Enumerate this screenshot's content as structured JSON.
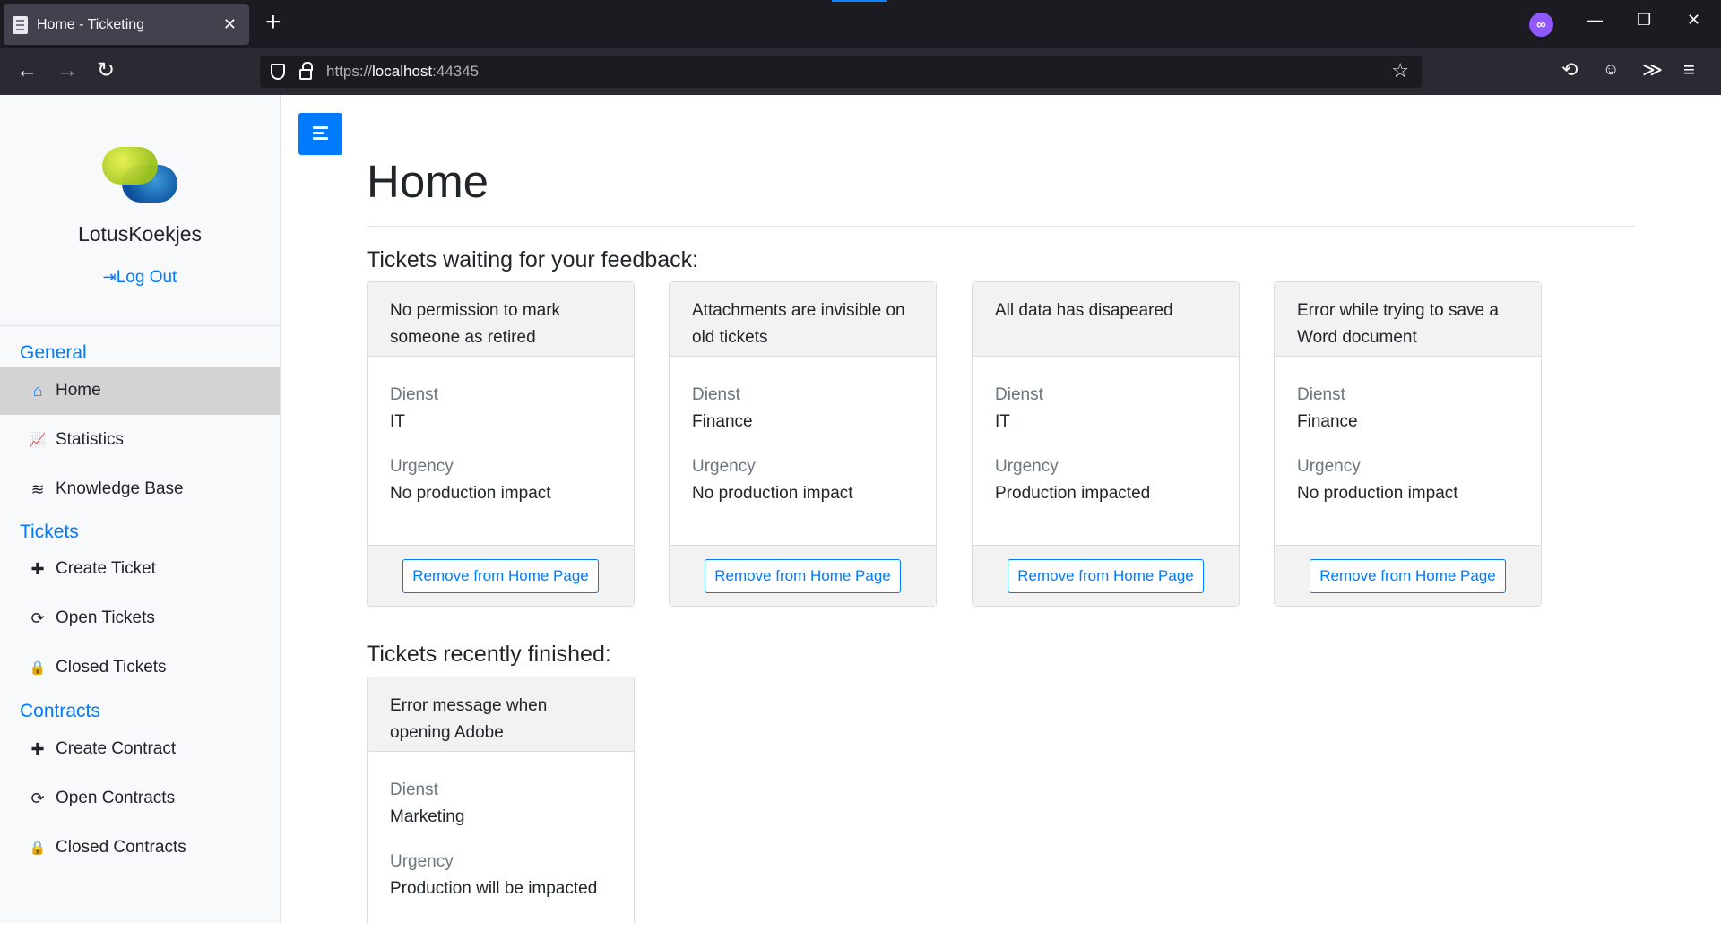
{
  "browser": {
    "tab_title": "Home - Ticketing",
    "tab_close": "✕",
    "new_tab": "+",
    "url_scheme": "https://",
    "url_host": "localhost",
    "url_port": ":44345",
    "private_icon": "∞",
    "window_minimize": "—",
    "window_restore": "❐",
    "window_close": "✕",
    "back_icon": "←",
    "forward_icon": "→",
    "reload_icon": "↻",
    "star_icon": "☆",
    "history_icon": "⟲",
    "extensions_icon": "≫",
    "menu_icon": "≡"
  },
  "sidebar": {
    "company": "LotusKoekjes",
    "logout_icon": "⇥",
    "logout_label": "Log Out",
    "sections": [
      {
        "title": "General",
        "items": [
          {
            "label": "Home",
            "icon": "⌂"
          },
          {
            "label": "Statistics",
            "icon": "📈"
          },
          {
            "label": "Knowledge Base",
            "icon": "≋"
          }
        ]
      },
      {
        "title": "Tickets",
        "items": [
          {
            "label": "Create Ticket",
            "icon": "✚"
          },
          {
            "label": "Open Tickets",
            "icon": "⟳"
          },
          {
            "label": "Closed Tickets",
            "icon": "🔒"
          }
        ]
      },
      {
        "title": "Contracts",
        "items": [
          {
            "label": "Create Contract",
            "icon": "✚"
          },
          {
            "label": "Open Contracts",
            "icon": "⟳"
          },
          {
            "label": "Closed Contracts",
            "icon": "🔒"
          }
        ]
      }
    ]
  },
  "main": {
    "title": "Home",
    "feedback_heading": "Tickets waiting for your feedback:",
    "finished_heading": "Tickets recently finished:",
    "dienst_label": "Dienst",
    "urgency_label": "Urgency",
    "remove_label": "Remove from Home Page",
    "feedback_tickets": [
      {
        "title": "No permission to mark someone as retired",
        "dienst": "IT",
        "urgency": "No production impact"
      },
      {
        "title": "Attachments are invisible on old tickets",
        "dienst": "Finance",
        "urgency": "No production impact"
      },
      {
        "title": "All data has disapeared",
        "dienst": "IT",
        "urgency": "Production impacted"
      },
      {
        "title": "Error while trying to save a Word document",
        "dienst": "Finance",
        "urgency": "No production impact"
      }
    ],
    "finished_tickets": [
      {
        "title": "Error message when opening Adobe",
        "dienst": "Marketing",
        "urgency": "Production will be impacted"
      }
    ]
  }
}
